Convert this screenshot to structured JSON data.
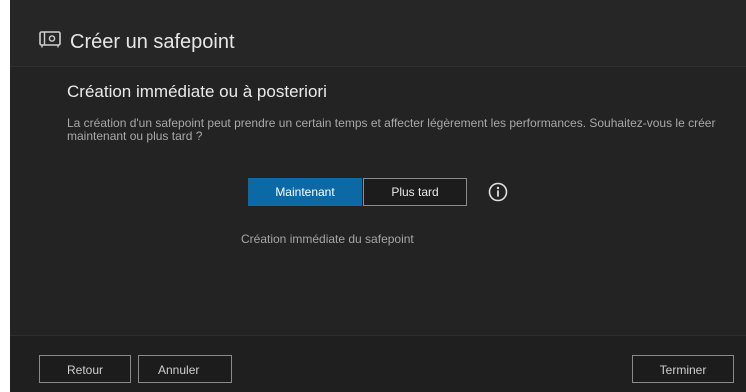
{
  "header": {
    "title": "Créer un safepoint",
    "icon": "safe-icon"
  },
  "content": {
    "heading": "Création immédiate ou à posteriori",
    "description": "La création d'un safepoint peut prendre un certain temps et affecter légèrement les performances. Souhaitez-vous le créer maintenant ou plus tard ?",
    "options": {
      "now_label": "Maintenant",
      "later_label": "Plus tard",
      "selected": "Maintenant"
    },
    "info_icon": "info-icon",
    "caption": "Création immédiate du safepoint"
  },
  "footer": {
    "back_label": "Retour",
    "cancel_label": "Annuler",
    "finish_label": "Terminer"
  },
  "colors": {
    "background": "#232323",
    "accent": "#0b6aa6"
  }
}
